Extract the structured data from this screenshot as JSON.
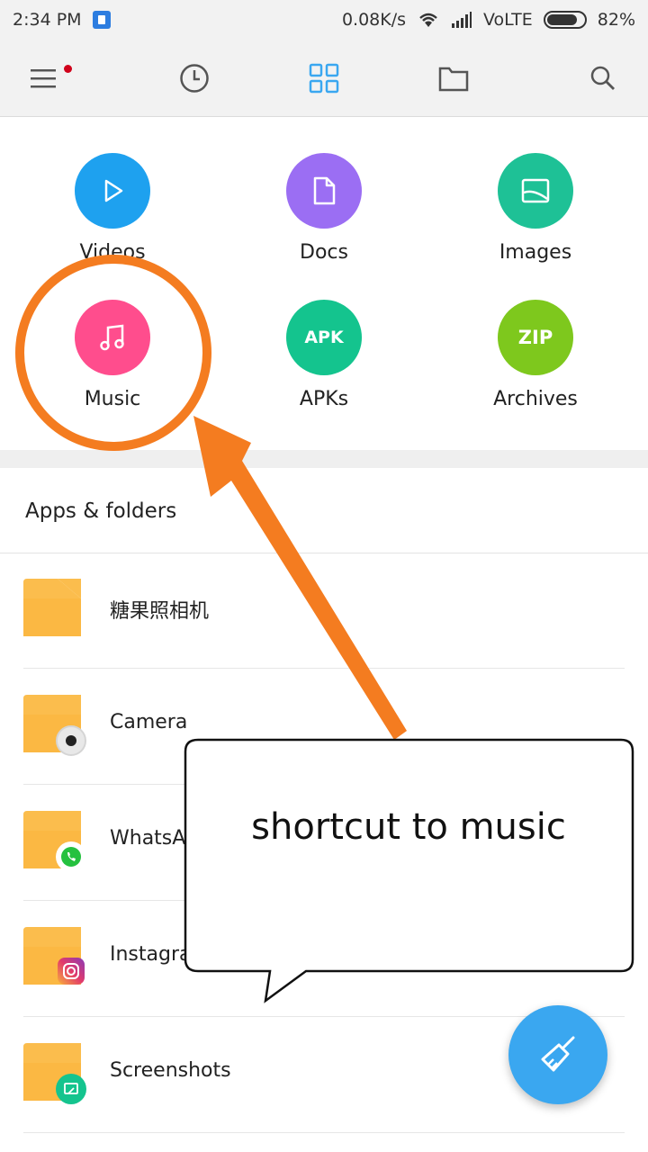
{
  "status_bar": {
    "time": "2:34 PM",
    "net_speed": "0.08K/s",
    "network": "VoLTE",
    "battery": "82%",
    "battery_level": 0.82
  },
  "toolbar": {
    "icons": [
      "menu-icon",
      "recent-clock-icon",
      "categories-grid-icon",
      "folder-icon",
      "search-icon"
    ],
    "active_color": "#3aa7f0"
  },
  "categories": [
    {
      "label": "Videos",
      "icon": "play-icon",
      "color": "#1ea1ef"
    },
    {
      "label": "Docs",
      "icon": "document-icon",
      "color": "#9b6ef3"
    },
    {
      "label": "Images",
      "icon": "image-icon",
      "color": "#1ec196"
    },
    {
      "label": "Music",
      "icon": "music-note-icon",
      "color": "#ff4d8d"
    },
    {
      "label": "APKs",
      "icon_text": "APK",
      "color": "#14c48e"
    },
    {
      "label": "Archives",
      "icon_text": "ZIP",
      "color": "#7ec81d"
    }
  ],
  "apps_folders": {
    "title": "Apps & folders",
    "items": [
      {
        "name": "糖果照相机",
        "badge": ""
      },
      {
        "name": "Camera",
        "badge": "camera-lens-icon"
      },
      {
        "name": "WhatsApp",
        "badge": "whatsapp-icon"
      },
      {
        "name": "Instagram",
        "badge": "instagram-icon"
      },
      {
        "name": "Screenshots",
        "badge": "screenshot-icon"
      }
    ]
  },
  "fab": {
    "icon": "broom-clean-icon",
    "color": "#3aa7f0"
  },
  "annotation": {
    "callout_text": "shortcut to music",
    "highlight_color": "#f47c20"
  }
}
